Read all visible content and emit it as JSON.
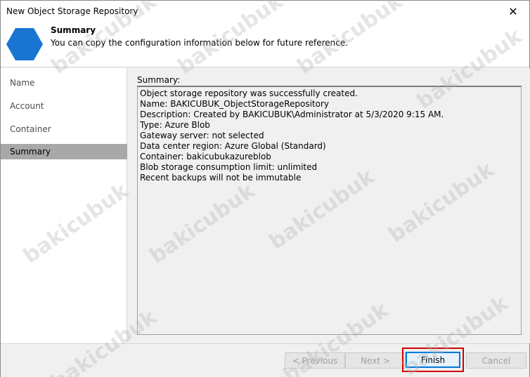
{
  "window": {
    "title": "New Object Storage Repository",
    "close_glyph": "✕"
  },
  "header": {
    "step_title": "Summary",
    "step_description": "You can copy the configuration information below for future reference.",
    "icon": "hexagon-icon",
    "icon_color": "#1a75d2"
  },
  "sidebar": {
    "items": [
      {
        "label": "Name",
        "active": false
      },
      {
        "label": "Account",
        "active": false
      },
      {
        "label": "Container",
        "active": false
      },
      {
        "label": "Summary",
        "active": true
      }
    ]
  },
  "main": {
    "summary_label": "Summary:",
    "summary_lines": [
      "Object storage repository was successfully created.",
      "Name: BAKICUBUK_ObjectStorageRepository",
      "Description: Created by BAKICUBUK\\Administrator at 5/3/2020 9:15 AM.",
      "Type: Azure Blob",
      "Gateway server: not selected",
      "Data center region: Azure Global (Standard)",
      "Container: bakicubukazureblob",
      "Blob storage consumption limit: unlimited",
      "Recent backups will not be immutable"
    ]
  },
  "footer": {
    "previous_label": "< Previous",
    "next_label": "Next >",
    "finish_label": "Finish",
    "cancel_label": "Cancel"
  },
  "watermark_text": "bakicubuk"
}
